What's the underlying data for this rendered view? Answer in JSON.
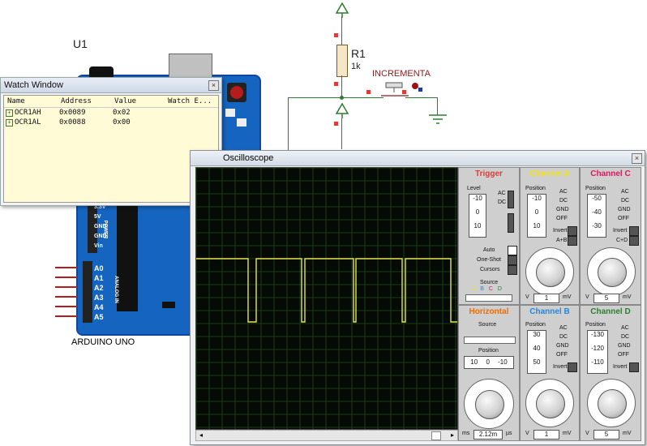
{
  "schematic": {
    "u1_ref": "U1",
    "r1_ref": "R1",
    "r1_value": "1k",
    "button_label": "INCREMENTA",
    "arduino_label": "ARDUINO UNO",
    "analog_pins": [
      "A0",
      "A1",
      "A2",
      "A3",
      "A4",
      "A5"
    ],
    "power_pins": [
      "3.3V",
      "5V",
      "GND",
      "GND",
      "Vin"
    ],
    "power_header": "POWER",
    "analog_header": "ANALOG IN"
  },
  "watch_window": {
    "title": "Watch Window",
    "columns": [
      "Name",
      "Address",
      "Value",
      "Watch E..."
    ],
    "rows": [
      {
        "name": "OCR1AH",
        "address": "0x0089",
        "value": "0x02"
      },
      {
        "name": "OCR1AL",
        "address": "0x0088",
        "value": "0x00"
      }
    ]
  },
  "oscilloscope": {
    "title": "Oscilloscope",
    "trace_color": "#e6e64d",
    "square_wave": {
      "low_level": 0,
      "high_level": 1,
      "edges": [
        64,
        74,
        130,
        134,
        194,
        197,
        254,
        258,
        314
      ]
    },
    "trigger": {
      "title": "Trigger",
      "level_label": "Level",
      "values": [
        "-10",
        "0",
        "10"
      ],
      "ac": "AC",
      "dc": "DC",
      "auto": "Auto",
      "oneshot": "One-Shot",
      "cursors": "Cursors",
      "source": "Source",
      "source_letters": [
        "A",
        "B",
        "C",
        "D"
      ],
      "color": "#e53935"
    },
    "channel_a": {
      "title": "Channel A",
      "position_label": "Position",
      "values": [
        "-10",
        "0",
        "10"
      ],
      "modes": [
        "AC",
        "DC",
        "GND",
        "OFF"
      ],
      "invert": "Invert",
      "combine": "A+B",
      "scale_left": "V",
      "scale_value": "1",
      "scale_right": "mV",
      "color": "#f4e400"
    },
    "channel_c": {
      "title": "Channel C",
      "position_label": "Position",
      "values": [
        "-50",
        "-40",
        "-30"
      ],
      "modes": [
        "AC",
        "DC",
        "GND",
        "OFF"
      ],
      "invert": "Invert",
      "combine": "C+D",
      "scale_left": "V",
      "scale_value": "5",
      "scale_right": "mV",
      "color": "#d81b60"
    },
    "horizontal": {
      "title": "Horizontal",
      "source_label": "Source",
      "position_label": "Position",
      "values": [
        "10",
        "0",
        "-10"
      ],
      "scale_left": "ms",
      "scale_value": "2.12m",
      "scale_right": "µs",
      "color": "#ef6c00"
    },
    "channel_b": {
      "title": "Channel B",
      "position_label": "Position",
      "values": [
        "30",
        "40",
        "50"
      ],
      "modes": [
        "AC",
        "DC",
        "GND",
        "OFF"
      ],
      "invert": "Invert",
      "scale_left": "V",
      "scale_value": "1",
      "scale_right": "mV",
      "color": "#1e88e5"
    },
    "channel_d": {
      "title": "Channel D",
      "position_label": "Position",
      "values": [
        "-130",
        "-120",
        "-110"
      ],
      "modes": [
        "AC",
        "DC",
        "GND",
        "OFF"
      ],
      "invert": "Invert",
      "scale_left": "V",
      "scale_value": "5",
      "scale_right": "mV",
      "color": "#2e7d32"
    }
  }
}
